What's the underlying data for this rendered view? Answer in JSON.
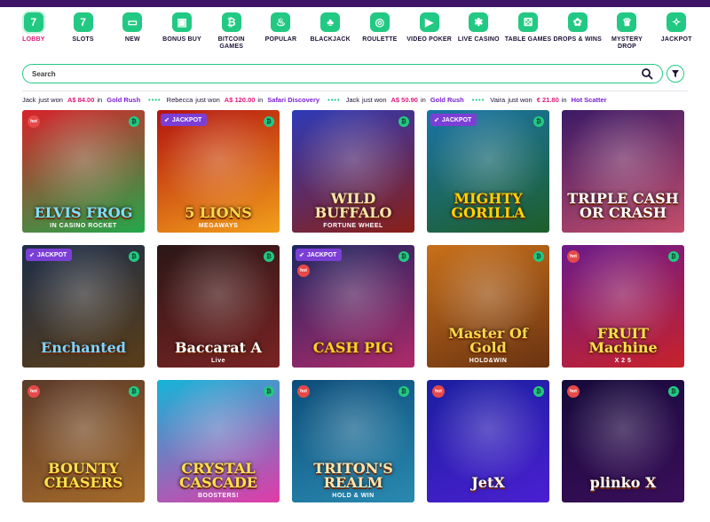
{
  "nav": {
    "items": [
      {
        "label": "LOBBY",
        "glyph": "7",
        "icon": "lobby-icon",
        "active": true
      },
      {
        "label": "SLOTS",
        "glyph": "7",
        "icon": "slots-icon"
      },
      {
        "label": "NEW",
        "glyph": "▭",
        "icon": "new-icon"
      },
      {
        "label": "BONUS BUY",
        "glyph": "▣",
        "icon": "bonus-buy-icon"
      },
      {
        "label": "BITCOIN GAMES",
        "glyph": "₿",
        "icon": "bitcoin-icon"
      },
      {
        "label": "POPULAR",
        "glyph": "♨",
        "icon": "popular-icon"
      },
      {
        "label": "BLACKJACK",
        "glyph": "♣",
        "icon": "blackjack-icon"
      },
      {
        "label": "ROULETTE",
        "glyph": "◎",
        "icon": "roulette-icon"
      },
      {
        "label": "VIDEO POKER",
        "glyph": "▶",
        "icon": "video-poker-icon"
      },
      {
        "label": "LIVE CASINO",
        "glyph": "✱",
        "icon": "live-casino-icon"
      },
      {
        "label": "TABLE GAMES",
        "glyph": "⚄",
        "icon": "table-games-icon"
      },
      {
        "label": "DROPS & WINS",
        "glyph": "✿",
        "icon": "drops-wins-icon"
      },
      {
        "label": "MYSTERY DROP",
        "glyph": "♛",
        "icon": "mystery-drop-icon"
      },
      {
        "label": "JACKPOT",
        "glyph": "✧",
        "icon": "jackpot-icon"
      }
    ]
  },
  "search": {
    "placeholder": "Search"
  },
  "ticker": [
    {
      "name": "Jack",
      "text": "just won",
      "amount": "A$ 84.00",
      "in": "in",
      "game": "Gold Rush"
    },
    {
      "name": "Rebecca",
      "text": "just won",
      "amount": "A$ 120.00",
      "in": "in",
      "game": "Safari Discovery"
    },
    {
      "name": "Jack",
      "text": "just won",
      "amount": "A$ 50.90",
      "in": "in",
      "game": "Gold Rush"
    },
    {
      "name": "Vaira",
      "text": "just won",
      "amount": "€ 21.80",
      "in": "in",
      "game": "Hot Scatter"
    }
  ],
  "games": [
    {
      "title": "ELVIS FROG",
      "sub": "IN CASINO ROCKET",
      "hot": true,
      "bitcoin": true,
      "colors": [
        "#d8222a",
        "#22a84a"
      ],
      "title_color": "#7ee0ff"
    },
    {
      "title": "5 LIONS",
      "sub": "MEGAWAYS",
      "jackpot": true,
      "bitcoin": true,
      "colors": [
        "#b3120f",
        "#f2a01b"
      ],
      "title_color": "#ffd84a"
    },
    {
      "title": "WILD BUFFALO",
      "sub": "FORTUNE WHEEL",
      "bitcoin": true,
      "colors": [
        "#2d3ab8",
        "#8a1f16"
      ],
      "title_color": "#ffe7b0"
    },
    {
      "title": "MIGHTY GORILLA",
      "sub": "",
      "jackpot": true,
      "bitcoin": true,
      "colors": [
        "#1a74a8",
        "#1e5e2a"
      ],
      "title_color": "#ffd400"
    },
    {
      "title": "TRIPLE CASH OR CRASH",
      "sub": "",
      "colors": [
        "#3b1a66",
        "#c44e6b"
      ],
      "title_color": "#ffffff"
    },
    {
      "title": "Enchanted",
      "sub": "",
      "jackpot": true,
      "bitcoin": true,
      "colors": [
        "#1c2e4a",
        "#5a3d17"
      ],
      "title_color": "#7fd5ff"
    },
    {
      "title": "Baccarat A",
      "sub": "Live",
      "bitcoin": true,
      "colors": [
        "#2b1717",
        "#7a2323"
      ],
      "title_color": "#ffffff"
    },
    {
      "title": "CASH PIG",
      "sub": "",
      "jackpot": true,
      "hot": true,
      "bitcoin": true,
      "colors": [
        "#1c2560",
        "#b02a6a"
      ],
      "title_color": "#ffcf2a"
    },
    {
      "title": "Master Of Gold",
      "sub": "HOLD&WIN",
      "bitcoin": true,
      "colors": [
        "#c8701a",
        "#6a3312"
      ],
      "title_color": "#ffd84a"
    },
    {
      "title": "FRUIT Machine",
      "sub": "X 2 5",
      "hot": true,
      "bitcoin": true,
      "colors": [
        "#6b1a8a",
        "#c8222a"
      ],
      "title_color": "#ffe24a"
    },
    {
      "title": "BOUNTY CHASERS",
      "sub": "",
      "hot": true,
      "bitcoin": true,
      "colors": [
        "#5a3a2a",
        "#a56a2a"
      ],
      "title_color": "#ffe24a"
    },
    {
      "title": "CRYSTAL CASCADE",
      "sub": "BOOSTERS!",
      "bitcoin": true,
      "colors": [
        "#14b5d8",
        "#e23aa8"
      ],
      "title_color": "#ffe24a"
    },
    {
      "title": "TRITON'S REALM",
      "sub": "HOLD & WIN",
      "hot": true,
      "bitcoin": true,
      "colors": [
        "#0c4d7a",
        "#2a8ab0"
      ],
      "title_color": "#ffe7b0"
    },
    {
      "title": "JetX",
      "sub": "",
      "hot": true,
      "bitcoin": true,
      "colors": [
        "#1a1ea0",
        "#4a1fd1"
      ],
      "title_color": "#ffffff"
    },
    {
      "title": "plinko X",
      "sub": "",
      "hot": true,
      "bitcoin": true,
      "colors": [
        "#160a3a",
        "#3a0e5a"
      ],
      "title_color": "#ffffff"
    }
  ],
  "jackpot_label": "JACKPOT",
  "hot_label": "hot",
  "btc_glyph": "₿",
  "colors": {
    "accent": "#22c983",
    "pink": "#e0177a",
    "purple": "#7a1fd1",
    "topbar": "#3f1466"
  }
}
